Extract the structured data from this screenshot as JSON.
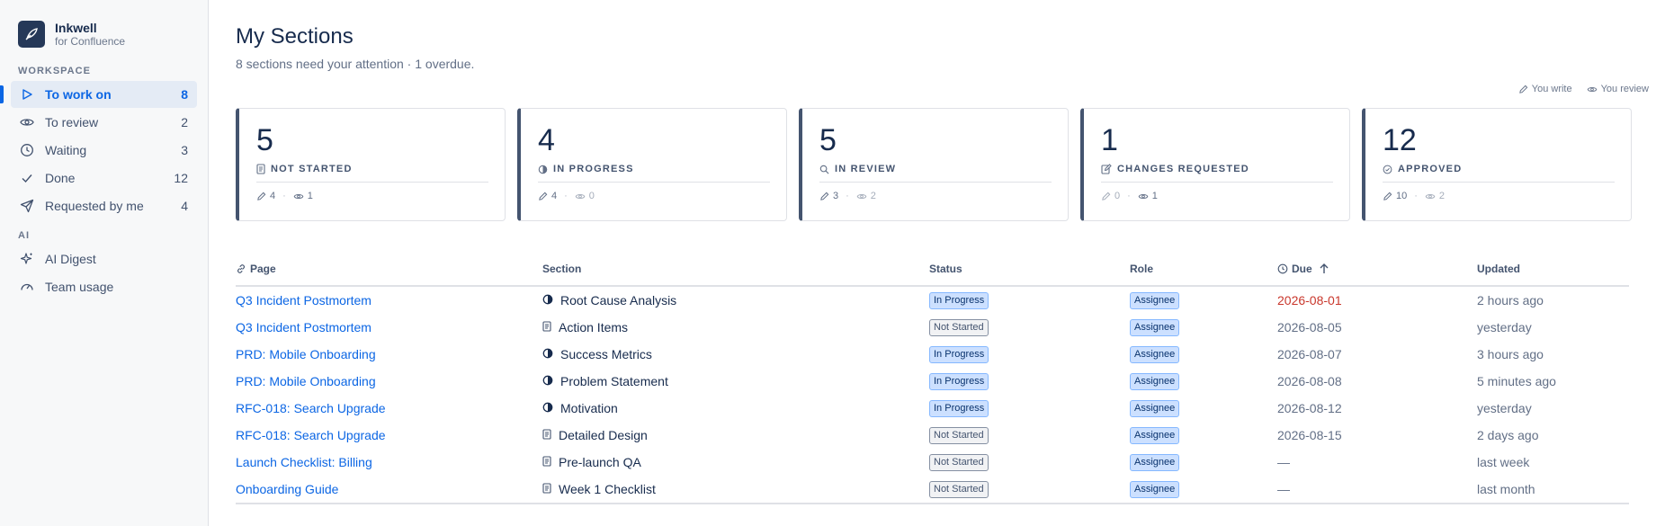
{
  "brand": {
    "name": "Inkwell",
    "sub": "for Confluence"
  },
  "sidebar": {
    "workspace_label": "WORKSPACE",
    "workspace_items": [
      {
        "label": "To work on",
        "count": "8",
        "icon": "play-outline-icon",
        "active": true
      },
      {
        "label": "To review",
        "count": "2",
        "icon": "eye-icon"
      },
      {
        "label": "Waiting",
        "count": "3",
        "icon": "clock-icon"
      },
      {
        "label": "Done",
        "count": "12",
        "icon": "check-icon"
      },
      {
        "label": "Requested by me",
        "count": "4",
        "icon": "send-icon"
      }
    ],
    "ai_label": "AI",
    "ai_items": [
      {
        "label": "AI Digest",
        "icon": "sparkle-icon"
      },
      {
        "label": "Team usage",
        "icon": "gauge-icon"
      }
    ]
  },
  "header": {
    "title": "My Sections",
    "subtitle": "8 sections need your attention · 1 overdue."
  },
  "legend": {
    "write": "You write",
    "review": "You review"
  },
  "cards": [
    {
      "num": "5",
      "label": "NOT STARTED",
      "write": "4",
      "review": "1",
      "icon": "document-icon"
    },
    {
      "num": "4",
      "label": "IN PROGRESS",
      "write": "4",
      "review": "0",
      "icon": "half-circle-icon"
    },
    {
      "num": "5",
      "label": "IN REVIEW",
      "write": "3",
      "review": "2",
      "icon": "search-icon"
    },
    {
      "num": "1",
      "label": "CHANGES REQUESTED",
      "write": "0",
      "review": "1",
      "icon": "edit-icon"
    },
    {
      "num": "12",
      "label": "APPROVED",
      "write": "10",
      "review": "2",
      "icon": "check-circle-icon"
    }
  ],
  "table": {
    "columns": {
      "page": "Page",
      "section": "Section",
      "status": "Status",
      "role": "Role",
      "due": "Due",
      "updated": "Updated"
    },
    "rows": [
      {
        "page": "Q3 Incident Postmortem",
        "section": "Root Cause Analysis",
        "section_icon": "half-circle-icon",
        "status": "In Progress",
        "role": "Assignee",
        "due": "2026-08-01",
        "overdue": true,
        "updated": "2 hours ago"
      },
      {
        "page": "Q3 Incident Postmortem",
        "section": "Action Items",
        "section_icon": "document-icon",
        "status": "Not Started",
        "role": "Assignee",
        "due": "2026-08-05",
        "updated": "yesterday"
      },
      {
        "page": "PRD: Mobile Onboarding",
        "section": "Success Metrics",
        "section_icon": "half-circle-icon",
        "status": "In Progress",
        "role": "Assignee",
        "due": "2026-08-07",
        "updated": "3 hours ago"
      },
      {
        "page": "PRD: Mobile Onboarding",
        "section": "Problem Statement",
        "section_icon": "half-circle-icon",
        "status": "In Progress",
        "role": "Assignee",
        "due": "2026-08-08",
        "updated": "5 minutes ago"
      },
      {
        "page": "RFC-018: Search Upgrade",
        "section": "Motivation",
        "section_icon": "half-circle-icon",
        "status": "In Progress",
        "role": "Assignee",
        "due": "2026-08-12",
        "updated": "yesterday"
      },
      {
        "page": "RFC-018: Search Upgrade",
        "section": "Detailed Design",
        "section_icon": "document-icon",
        "status": "Not Started",
        "role": "Assignee",
        "due": "2026-08-15",
        "updated": "2 days ago"
      },
      {
        "page": "Launch Checklist: Billing",
        "section": "Pre-launch QA",
        "section_icon": "document-icon",
        "status": "Not Started",
        "role": "Assignee",
        "due": "—",
        "updated": "last week"
      },
      {
        "page": "Onboarding Guide",
        "section": "Week 1 Checklist",
        "section_icon": "document-icon",
        "status": "Not Started",
        "role": "Assignee",
        "due": "—",
        "updated": "last month"
      }
    ]
  },
  "colors": {
    "accent": "#0c66e4",
    "overdue": "#c9372c",
    "card_border": "#44546f"
  }
}
